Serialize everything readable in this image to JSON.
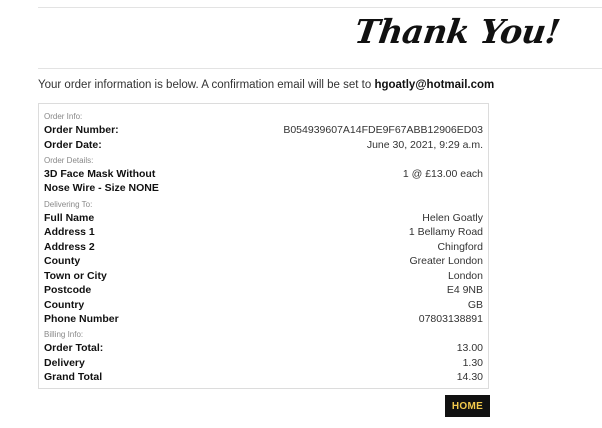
{
  "header": {
    "title": "Thank You!"
  },
  "intro": {
    "text": "Your order information is below. A confirmation email will be set to ",
    "email": "hgoatly@hotmail.com"
  },
  "order_info": {
    "section_label": "Order Info:",
    "number_label": "Order Number:",
    "number_value": "B054939607A14FDE9F67ABB12906ED03",
    "date_label": "Order Date:",
    "date_value": "June 30, 2021, 9:29 a.m."
  },
  "order_details": {
    "section_label": "Order Details:",
    "item_name_line1": "3D Face Mask Without",
    "item_name_line2": "Nose Wire - Size NONE",
    "item_qty_price": "1 @ £13.00 each"
  },
  "delivering_to": {
    "section_label": "Delivering To:",
    "rows": [
      {
        "label": "Full Name",
        "value": "Helen Goatly"
      },
      {
        "label": "Address 1",
        "value": "1 Bellamy Road"
      },
      {
        "label": "Address 2",
        "value": "Chingford"
      },
      {
        "label": "County",
        "value": "Greater London"
      },
      {
        "label": "Town or City",
        "value": "London"
      },
      {
        "label": "Postcode",
        "value": "E4 9NB"
      },
      {
        "label": "Country",
        "value": "GB"
      },
      {
        "label": "Phone Number",
        "value": "07803138891"
      }
    ]
  },
  "billing_info": {
    "section_label": "Billing Info:",
    "rows": [
      {
        "label": "Order Total:",
        "value": "13.00"
      },
      {
        "label": "Delivery",
        "value": "1.30"
      },
      {
        "label": "Grand Total",
        "value": "14.30"
      }
    ]
  },
  "home_button": {
    "label": "HOME"
  },
  "colors": {
    "button_bg": "#111111",
    "button_text": "#f2c94c"
  }
}
